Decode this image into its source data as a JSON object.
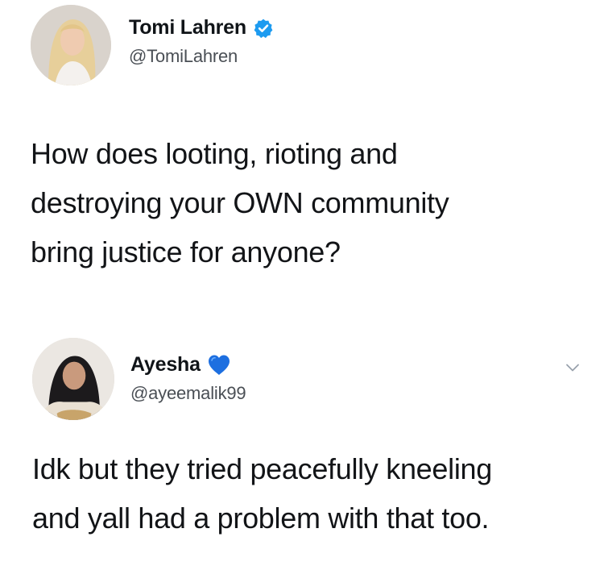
{
  "tweets": [
    {
      "author": {
        "display_name": "Tomi Lahren",
        "handle": "@TomiLahren",
        "badge_icon": "verified-badge-icon",
        "badge_color": "#1d9bf0"
      },
      "text": "How does looting, rioting and\ndestroying your OWN community\nbring justice for anyone?"
    },
    {
      "author": {
        "display_name": "Ayesha",
        "handle": "@ayeemalik99",
        "badge_icon": "blue-heart-icon",
        "badge_color": "#1d6fe0"
      },
      "menu_icon": "chevron-down-icon",
      "text": "Idk but they tried peacefully kneeling\nand yall had a problem with that too."
    }
  ],
  "colors": {
    "text": "#111418",
    "secondary_text": "#4a4f55",
    "background": "#ffffff"
  }
}
